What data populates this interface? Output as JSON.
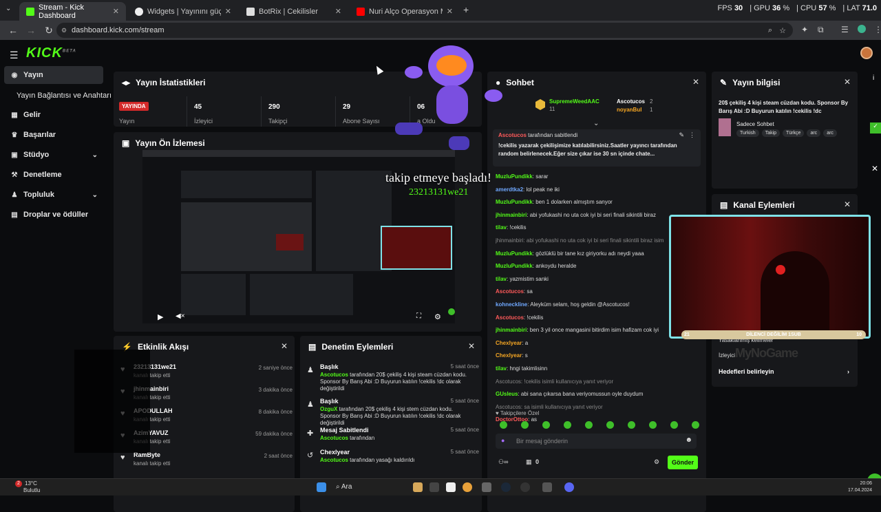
{
  "tabs": [
    {
      "label": "Stream - Kick Dashboard",
      "color": "#53fc18"
    },
    {
      "label": "Widgets | Yayınını güçlendirme",
      "color": "#ffffff"
    },
    {
      "label": "BotRix | Cekilisler",
      "color": "#ffffff"
    },
    {
      "label": "Nuri Alço Operasyon Müziği",
      "color": "#ff0000"
    }
  ],
  "tools": {
    "fps_label": "FPS",
    "fps": "30",
    "gpu_label": "GPU",
    "gpu": "36",
    "gpu_unit": "%",
    "cpu_label": "CPU",
    "cpu": "57",
    "cpu_unit": "%",
    "lat_label": "LAT",
    "lat": "71.0"
  },
  "url": "dashboard.kick.com/stream",
  "brand": {
    "logo": "KICK",
    "sup": "BETA",
    "accent": "#53fc18"
  },
  "sidebar": [
    {
      "label": "Yayın",
      "icon": "broadcast-icon",
      "selected": true
    },
    {
      "label": "Yayın Bağlantısı ve Anahtarı",
      "icon": "",
      "selected": false
    },
    {
      "label": "Gelir",
      "icon": "revenue-icon",
      "selected": false
    },
    {
      "label": "Başarılar",
      "icon": "trophy-icon",
      "selected": false
    },
    {
      "label": "Stüdyo",
      "icon": "studio-icon",
      "selected": false,
      "chev": true
    },
    {
      "label": "Denetleme",
      "icon": "moderation-icon",
      "selected": false
    },
    {
      "label": "Topluluk",
      "icon": "community-icon",
      "selected": false,
      "chev": true
    },
    {
      "label": "Droplar ve ödüller",
      "icon": "drops-icon",
      "selected": false
    }
  ],
  "stats": {
    "title": "Yayın İstatistikleri",
    "live": "YAYINDA",
    "live_label": "Yayın",
    "items": [
      {
        "value": "45",
        "label": "İzleyici"
      },
      {
        "value": "290",
        "label": "Takipçi"
      },
      {
        "value": "29",
        "label": "Abone Sayısı"
      },
      {
        "value": "06",
        "label": "a Oldu"
      }
    ]
  },
  "preview": {
    "title": "Yayın Ön İzlemesi"
  },
  "overlay": {
    "follow_text": "takip etmeye başladı!",
    "follow_name": "23213131we21",
    "cam_label": "DİLENCİ DEĞİLİM 1SUB",
    "cam_left": "21",
    "cam_right": "10",
    "watermark": "MyNoGame"
  },
  "activity": {
    "title": "Etkinlik Akışı",
    "items": [
      {
        "name": "23213131we21",
        "sub": "kanalı takip etti",
        "time": "2 saniye önce"
      },
      {
        "name": "jhinmainbiri",
        "sub": "kanalı takip etti",
        "time": "3 dakika önce"
      },
      {
        "name": "APODULLAH",
        "sub": "kanalı takip etti",
        "time": "8 dakika önce"
      },
      {
        "name": "AzimYAVUZ",
        "sub": "kanalı takip etti",
        "time": "59 dakika önce"
      },
      {
        "name": "RamByte",
        "sub": "kanalı takip etti",
        "time": "2 saat önce"
      }
    ]
  },
  "moderation": {
    "title": "Denetim Eylemleri",
    "items": [
      {
        "head": "Başlık",
        "user": "Ascotucos",
        "rest": " tarafından 20$ çekiliş 4 kişi steam cüzdan kodu. Sponsor By Barış Abi :D Buyurun katılın !cekilis !dc olarak değiştirildi",
        "time": "5 saat önce"
      },
      {
        "head": "Başlık",
        "user": "OzguX",
        "rest": " tarafından 20$ çekiliş 4 kişi stem cüzdan kodu. Sponsor By Barış Abi :D Buyurun katılın !cekilis !dc olarak değiştirildi",
        "time": "5 saat önce"
      },
      {
        "head": "Mesaj Sabitlendi",
        "user": "Ascotucos",
        "rest": " tarafından",
        "time": "5 saat önce"
      },
      {
        "head": "Chexlyear",
        "user": "Ascotucos",
        "rest": " tarafından yasağı kaldırıldı",
        "time": "5 saat önce"
      }
    ]
  },
  "chat": {
    "title": "Sohbet",
    "top": [
      {
        "name": "SupremeWeedAAC",
        "count": "11"
      },
      {
        "name": "Ascotucos",
        "count": "2"
      },
      {
        "name": "noyanBul",
        "count": "1"
      }
    ],
    "pinned_by": "tarafından sabitlendi",
    "pinned_user": "Ascotucos",
    "pinned_text": "!cekilis yazarak çekilişimize katılabilirsiniz.Saatler yayıncı tarafından random belirlenecek.Eğer size çıkar ise 30 sn içinde chate...",
    "messages": [
      {
        "user": "MuzluPundikk",
        "color": "#53fc18",
        "text": "sarar"
      },
      {
        "user": "amerdtka2",
        "color": "#6fa8ff",
        "text": "lol peak ne iki"
      },
      {
        "user": "MuzluPundikk",
        "color": "#53fc18",
        "text": "ben 1 dolarken almıştım sanyor"
      },
      {
        "user": "jhinmainbiri",
        "color": "#53fc18",
        "text": "abi yofukashi no uta cok iyi bi seri finali sikintili biraz"
      },
      {
        "user": "tilav",
        "color": "#53fc18",
        "text": "!cekilis"
      },
      {
        "user": "",
        "color": "#888",
        "text": "jhinmainbiri: abi yofukashi no uta cok iyi bi seri finali sikintili biraz isim"
      },
      {
        "user": "MuzluPundikk",
        "color": "#53fc18",
        "text": "gözlüklü bir tane kız giriyorku adı neydi yaaa"
      },
      {
        "user": "MuzluPundikk",
        "color": "#53fc18",
        "text": "ankoydu heralde"
      },
      {
        "user": "tilav",
        "color": "#53fc18",
        "text": "yazmistim sanki"
      },
      {
        "user": "Ascotucos",
        "color": "#ff5a5a",
        "text": "sa"
      },
      {
        "user": "kohneckline",
        "color": "#6fa8ff",
        "text": "Aleyküm selam, hoş geldin @Ascotucos!"
      },
      {
        "user": "Ascotucos",
        "color": "#ff5a5a",
        "text": "!cekilis"
      },
      {
        "user": "jhinmainbiri",
        "color": "#53fc18",
        "text": "ben 3 yil once mangasini bitirdim isim hafizam cok iyi"
      },
      {
        "user": "Chexlyear",
        "color": "#f5a623",
        "text": "a"
      },
      {
        "user": "Chexlyear",
        "color": "#f5a623",
        "text": "s"
      },
      {
        "user": "tilav",
        "color": "#53fc18",
        "text": "hngi takimlisinn"
      },
      {
        "user": "",
        "color": "#888",
        "text": "Ascotucos: !cekilis isimli kullanıcıya yanıt veriyor"
      },
      {
        "user": "GUsleus",
        "color": "#53fc18",
        "text": "abi sana çıkarsa bana veriyomussun oyle duydum"
      },
      {
        "user": "",
        "color": "#888",
        "text": "Ascotucos: sa isimli kullanıcıya yanıt veriyor"
      },
      {
        "user": "DoctorOttoo",
        "color": "#ff5a5a",
        "text": "as"
      }
    ],
    "special": "Takipçilere Özel",
    "placeholder": "Bir mesaj gönderin",
    "count": "0",
    "send": "Gönder"
  },
  "info": {
    "title": "Yayın bilgisi",
    "stream_title": "20$ çekiliş 4 kişi steam cüzdan kodu. Sponsor By Barış Abi :D Buyurun katılın !cekilis !dc",
    "category": "Sadece Sohbet",
    "tags": [
      "Turkish",
      "Takip",
      "Türkçe",
      "arc",
      "arc"
    ]
  },
  "channel": {
    "title": "Kanal Eylemleri",
    "items": [
      {
        "label": "Yasaklanmış kelimeler"
      },
      {
        "label": "İzleyici"
      },
      {
        "label": "Hedefleri belirleyin"
      }
    ]
  },
  "taskbar": {
    "weather_temp": "13°C",
    "weather_text": "Bulutlu",
    "badge": "2",
    "search": "Ara",
    "time": "20:06",
    "date": "17.04.2024"
  }
}
